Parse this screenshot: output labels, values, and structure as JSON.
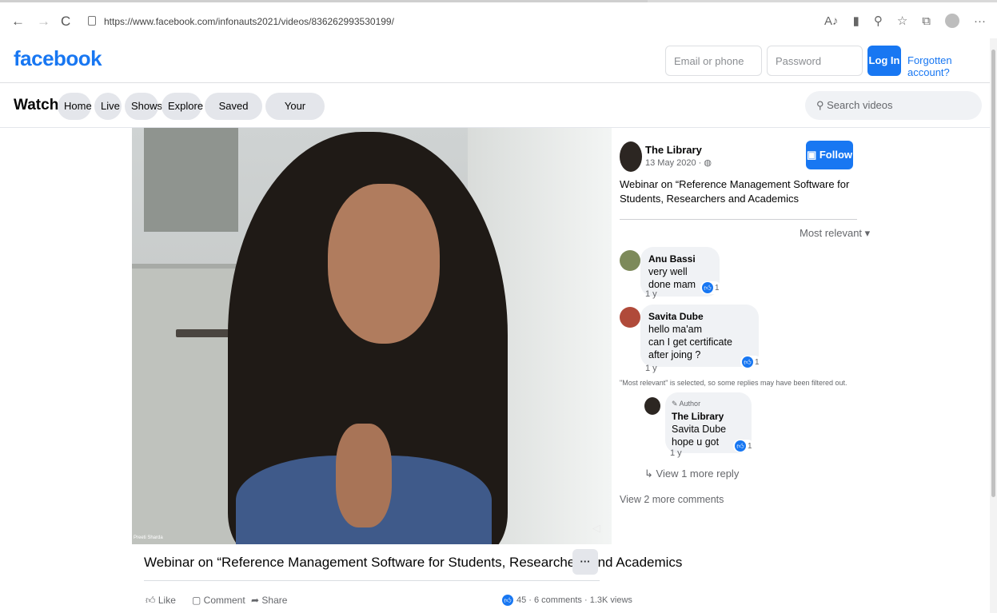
{
  "browser": {
    "url": "https://www.facebook.com/infonauts2021/videos/836262993530199/",
    "back": "←",
    "forward": "→",
    "reload": "C"
  },
  "header": {
    "logo": "facebook",
    "email_placeholder": "Email or phone",
    "password_placeholder": "Password",
    "login_label": "Log In",
    "forgot_label": "Forgotten account?"
  },
  "watchbar": {
    "title": "Watch",
    "tabs": [
      "Home",
      "Live",
      "Shows",
      "Explore",
      "Saved videos",
      "Your watchlist"
    ],
    "search_placeholder": "Search videos"
  },
  "video": {
    "presenter_tag": "Preeti Sharda",
    "title": "Webinar on “Reference Management Software for Students, Researchers and Academics",
    "more_label": "···",
    "actions": {
      "like": "Like",
      "comment": "Comment",
      "share": "Share"
    },
    "stats": "45 · 6 comments · 1.3K views"
  },
  "sidebar": {
    "page_name": "The Library",
    "date": "13 May 2020 · ",
    "follow_label": "Follow",
    "description": "Webinar on “Reference Management Software for Students, Researchers and Academics",
    "sort_label": "Most relevant ▾",
    "comments": [
      {
        "author": "Anu Bassi",
        "text": "very well done mam",
        "time": "1 y",
        "reactions": "1"
      },
      {
        "author": "Savita Dube",
        "text": "hello ma'am",
        "text2": "can I get certificate after joing ?",
        "time": "1 y",
        "reactions": "1"
      }
    ],
    "filter_note": "\"Most relevant\" is selected, so some replies may have been filtered out.",
    "reply": {
      "badge": "Author",
      "author": "The Library",
      "text": "Savita Dube hope u got",
      "time": "1 y",
      "reactions": "1"
    },
    "view_reply": "View 1 more reply",
    "view_more": "View 2 more comments"
  }
}
